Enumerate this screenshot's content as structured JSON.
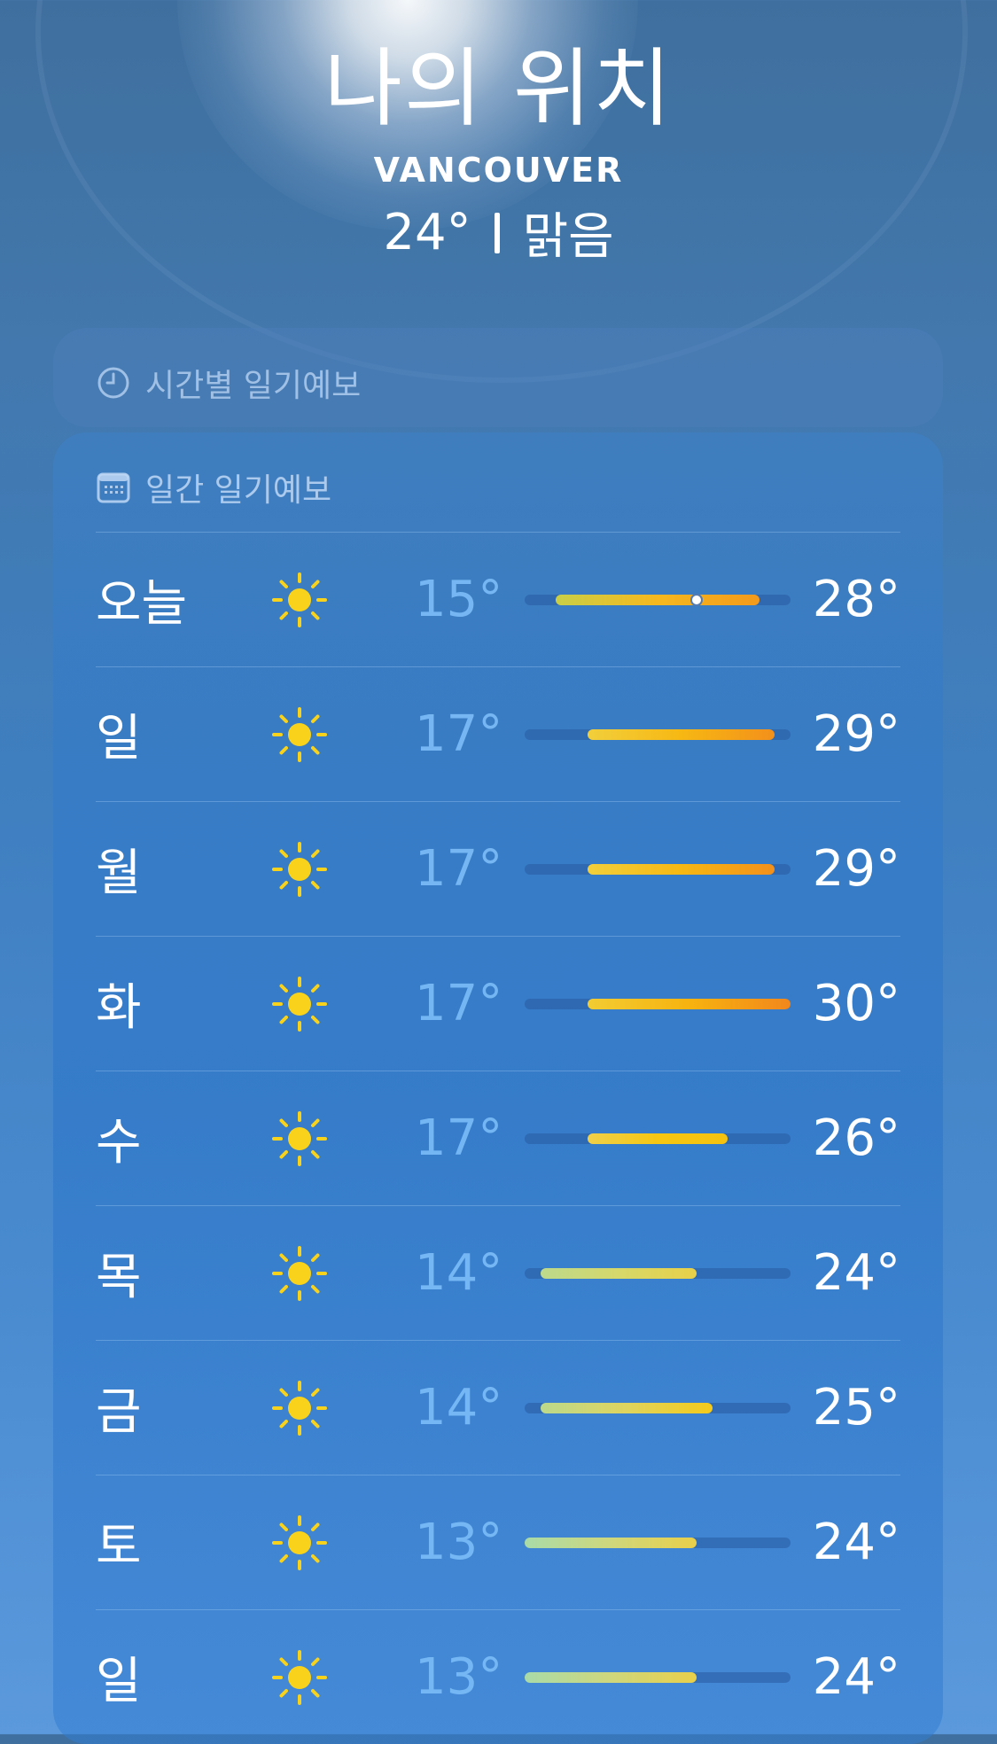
{
  "header": {
    "title": "나의 위치",
    "location": "VANCOUVER",
    "current_temp": "24°",
    "condition": "맑음"
  },
  "hourly": {
    "label": "시간별 일기예보",
    "icon": "clock-icon"
  },
  "daily": {
    "label": "일간 일기예보",
    "icon": "calendar-icon",
    "range_min": 13,
    "range_max": 30,
    "days": [
      {
        "day": "오늘",
        "icon": "sun-icon",
        "low": "15°",
        "high": "28°",
        "low_val": 15,
        "high_val": 28,
        "current_val": 24,
        "colors": [
          "#c9cf47",
          "#f6b81e",
          "#f39a1c"
        ]
      },
      {
        "day": "일",
        "icon": "sun-icon",
        "low": "17°",
        "high": "29°",
        "low_val": 17,
        "high_val": 29,
        "colors": [
          "#f1cf3c",
          "#f7b813",
          "#f3901b"
        ]
      },
      {
        "day": "월",
        "icon": "sun-icon",
        "low": "17°",
        "high": "29°",
        "low_val": 17,
        "high_val": 29,
        "colors": [
          "#f1cf3c",
          "#f7b813",
          "#f3901b"
        ]
      },
      {
        "day": "화",
        "icon": "sun-icon",
        "low": "17°",
        "high": "30°",
        "low_val": 17,
        "high_val": 30,
        "colors": [
          "#f2cc33",
          "#f7b30f",
          "#f2871c"
        ]
      },
      {
        "day": "수",
        "icon": "sun-icon",
        "low": "17°",
        "high": "26°",
        "low_val": 17,
        "high_val": 26,
        "colors": [
          "#efd04a",
          "#f6c612",
          "#f5c210"
        ]
      },
      {
        "day": "목",
        "icon": "sun-icon",
        "low": "14°",
        "high": "24°",
        "low_val": 14,
        "high_val": 24,
        "colors": [
          "#bcd98c",
          "#d6d86a",
          "#e9d048"
        ]
      },
      {
        "day": "금",
        "icon": "sun-icon",
        "low": "14°",
        "high": "25°",
        "low_val": 14,
        "high_val": 25,
        "colors": [
          "#bcd98c",
          "#dfd45e",
          "#f5ca1a"
        ]
      },
      {
        "day": "토",
        "icon": "sun-icon",
        "low": "13°",
        "high": "24°",
        "low_val": 13,
        "high_val": 24,
        "colors": [
          "#a9dba8",
          "#cfd77c",
          "#e9cf4a"
        ]
      },
      {
        "day": "일",
        "icon": "sun-icon",
        "low": "13°",
        "high": "24°",
        "low_val": 13,
        "high_val": 24,
        "colors": [
          "#a9dba8",
          "#cfd77c",
          "#e9cf4a"
        ]
      }
    ]
  }
}
